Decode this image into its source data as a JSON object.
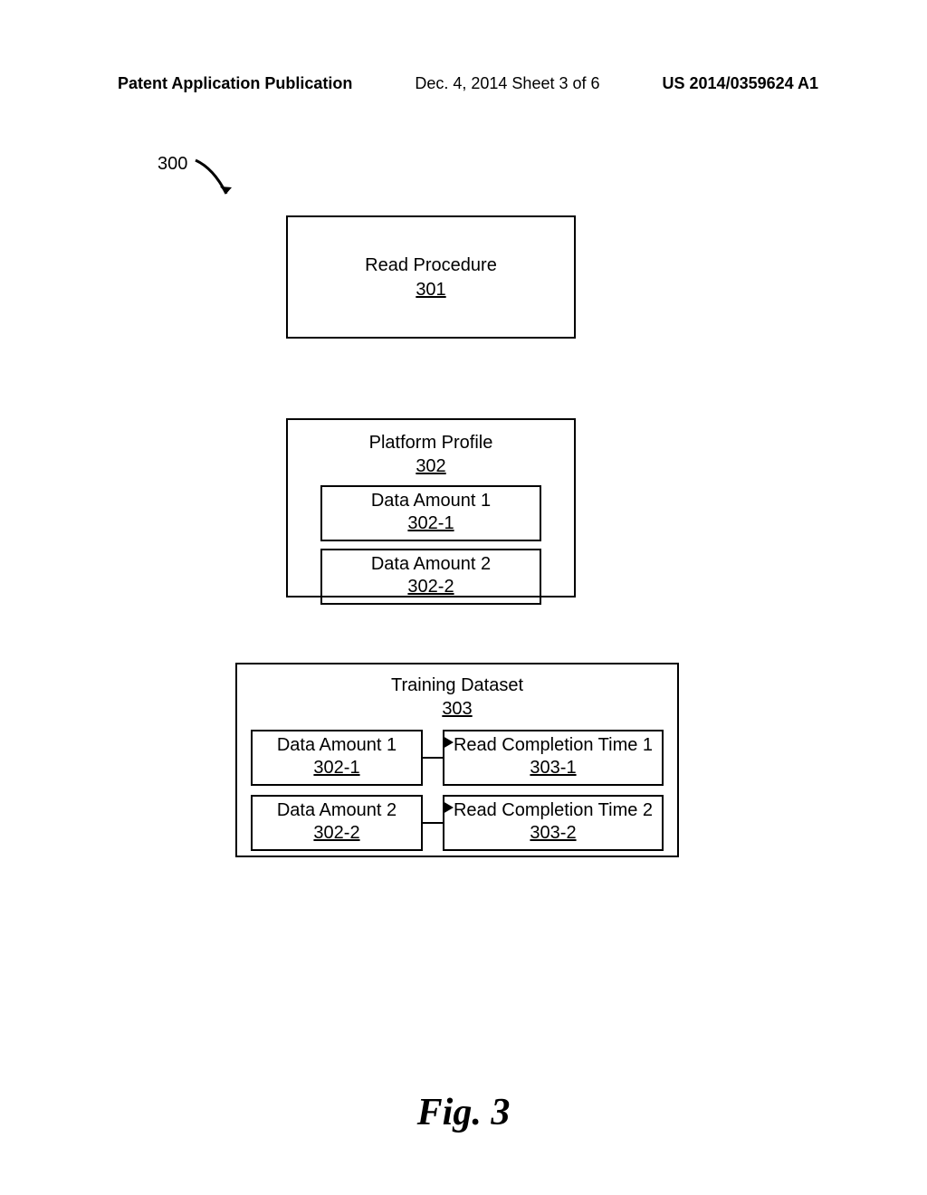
{
  "header": {
    "left": "Patent Application Publication",
    "center": "Dec. 4, 2014  Sheet 3 of 6",
    "right": "US 2014/0359624 A1"
  },
  "ref300": "300",
  "box301": {
    "title": "Read Procedure",
    "ref": "301"
  },
  "box302": {
    "title": "Platform Profile",
    "ref": "302",
    "item1": {
      "title": "Data Amount 1",
      "ref": "302-1"
    },
    "item2": {
      "title": "Data Amount 2",
      "ref": "302-2"
    }
  },
  "box303": {
    "title": "Training Dataset",
    "ref": "303",
    "row1": {
      "left": {
        "title": "Data Amount 1",
        "ref": "302-1"
      },
      "right": {
        "title": "Read Completion Time 1",
        "ref": "303-1"
      }
    },
    "row2": {
      "left": {
        "title": "Data Amount 2",
        "ref": "302-2"
      },
      "right": {
        "title": "Read Completion Time 2",
        "ref": "303-2"
      }
    }
  },
  "figure_label": "Fig. 3"
}
